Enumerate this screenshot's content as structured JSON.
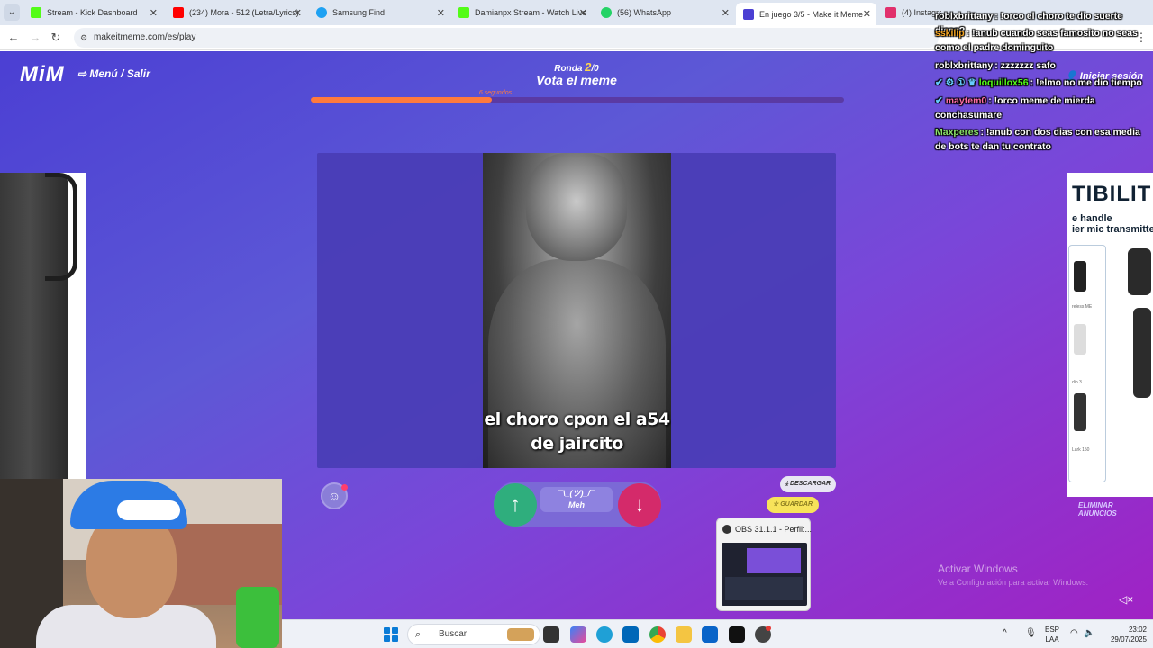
{
  "tabs": [
    {
      "title": "Stream - Kick Dashboard",
      "color": "#53fc18"
    },
    {
      "title": "(234) Mora - 512 (Letra/Lyrics)",
      "color": "#ff0000"
    },
    {
      "title": "Samsung Find",
      "color": "#1ea1f2"
    },
    {
      "title": "Damianpx Stream - Watch Live",
      "color": "#53fc18"
    },
    {
      "title": "(56) WhatsApp",
      "color": "#25d366"
    },
    {
      "title": "En juego 3/5 - Make it Meme",
      "color": "#4b3fd3"
    },
    {
      "title": "(4) Instagra",
      "color": "#e1306c"
    }
  ],
  "address": {
    "url": "makeitmeme.com/es/play"
  },
  "game": {
    "logo": "MiM",
    "menu": "Menú / Salir",
    "round_prefix": "Ronda",
    "round_number": "2",
    "round_total": "/0",
    "vote_title": "Vota el meme",
    "timer_label": "6 segundos",
    "timer_progress": 0.34,
    "login": "Iniciar sesión",
    "meme_caption": "el choro cpon el a54 de jaircito",
    "meh_face": "¯\\_(ツ)_/¯",
    "meh_label": "Meh",
    "download": "DESCARGAR",
    "save": "GUARDAR",
    "remove_ads": "ELIMINAR ANUNCIOS"
  },
  "ad": {
    "headline": "TIBILIT",
    "line1": "e handle",
    "line2": "ier mic transmitte",
    "label1": "reless ME",
    "label2": "dio 3",
    "label3": "Lark 150"
  },
  "windows": {
    "activate_title": "Activar Windows",
    "activate_sub": "Ve a Configuración para activar Windows."
  },
  "obs": {
    "title": "OBS 31.1.1 - Perfil:..."
  },
  "chat": [
    {
      "user": "roblxbrittany",
      "color": "#ffffff",
      "text": ": !orco el choro te dio suerte dices?"
    },
    {
      "user": "sskilip",
      "color": "#f5a623",
      "text": ": !anub cuando seas famosito no seas como el padre dominguito"
    },
    {
      "user": "roblxbrittany",
      "color": "#ffffff",
      "text": ": zzzzzzz safo"
    },
    {
      "user": "loquillox56",
      "color": "#53fc18",
      "text": ": !elmo no me dio tiempo"
    },
    {
      "user": "maytem0",
      "color": "#ff6ea8",
      "text": ": !orco meme de mierda conchasumare"
    },
    {
      "user": "Maxperes",
      "color": "#8be36b",
      "text": ": !anub con dos dias con esa media de bots te dan tu contrato"
    }
  ],
  "taskbar": {
    "search_placeholder": "Buscar",
    "lang1": "ESP",
    "lang2": "LAA",
    "time": "23:02",
    "date": "29/07/2025"
  }
}
